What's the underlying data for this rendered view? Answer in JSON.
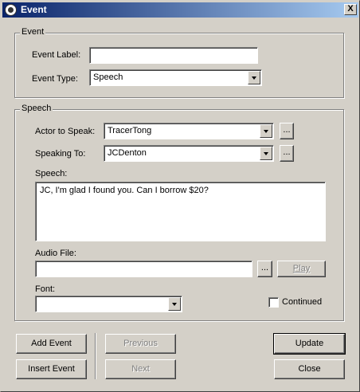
{
  "window": {
    "title": "Event",
    "close_glyph": "X"
  },
  "event_group": {
    "label": "Event",
    "event_label": {
      "label": "Event Label:",
      "value": ""
    },
    "event_type": {
      "label": "Event Type:",
      "value": "Speech"
    }
  },
  "speech_group": {
    "label": "Speech",
    "actor": {
      "label": "Actor to Speak:",
      "value": "TracerTong",
      "browse": "..."
    },
    "speaking_to": {
      "label": "Speaking To:",
      "value": "JCDenton",
      "browse": "..."
    },
    "speech": {
      "label": "Speech:",
      "value": "JC, I'm glad I found you.  Can I borrow $20?"
    },
    "audio_file": {
      "label": "Audio File:",
      "value": "",
      "browse": "...",
      "play": "Play"
    },
    "font": {
      "label": "Font:",
      "value": ""
    },
    "continued": {
      "label": "Continued",
      "checked": false
    }
  },
  "buttons": {
    "add_event": "Add Event",
    "insert_event": "Insert Event",
    "previous": "Previous",
    "next": "Next",
    "update": "Update",
    "close": "Close"
  },
  "icons": {
    "title": "app-icon",
    "close": "close-icon",
    "dropdown": "chevron-down-icon"
  }
}
